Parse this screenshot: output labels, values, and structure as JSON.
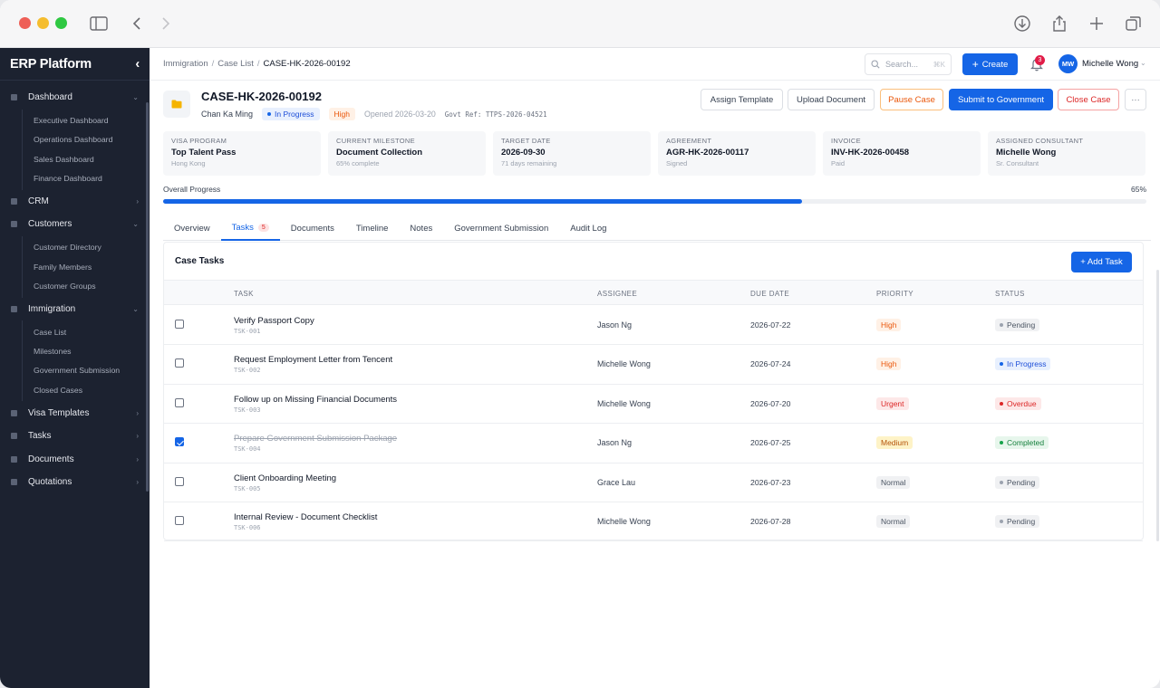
{
  "sidebar": {
    "brand": "ERP Platform",
    "groups": [
      {
        "label": "Dashboard",
        "subs": [
          "Executive Dashboard",
          "Operations Dashboard",
          "Sales Dashboard",
          "Finance Dashboard"
        ]
      },
      {
        "label": "CRM",
        "subs": []
      },
      {
        "label": "Customers",
        "subs": [
          "Customer Directory",
          "Family Members",
          "Customer Groups"
        ]
      },
      {
        "label": "Immigration",
        "subs": [
          "Case List",
          "Milestones",
          "Government Submission",
          "Closed Cases"
        ]
      },
      {
        "label": "Visa Templates",
        "subs": []
      },
      {
        "label": "Tasks",
        "subs": []
      },
      {
        "label": "Documents",
        "subs": []
      },
      {
        "label": "Quotations",
        "subs": []
      }
    ]
  },
  "topbar": {
    "breadcrumb": [
      "Immigration",
      "Case List",
      "CASE-HK-2026-00192"
    ],
    "search_placeholder": "Search...",
    "search_shortcut": "⌘K",
    "create_label": "Create",
    "notif_count": "3",
    "user_initials": "MW",
    "user_name": "Michelle Wong"
  },
  "case": {
    "id": "CASE-HK-2026-00192",
    "client": "Chan Ka Ming",
    "status": "In Progress",
    "priority": "High",
    "opened": "Opened 2026-03-20",
    "gov_ref": "Govt Ref: TTPS-2026-04521"
  },
  "actions": {
    "assign_template": "Assign Template",
    "upload_document": "Upload Document",
    "pause_case": "Pause Case",
    "submit": "Submit to Government",
    "close_case": "Close Case",
    "more": "···"
  },
  "cards": [
    {
      "key": "VISA PROGRAM",
      "value": "Top Talent Pass",
      "sub": "Hong Kong"
    },
    {
      "key": "CURRENT MILESTONE",
      "value": "Document Collection",
      "sub": "65% complete"
    },
    {
      "key": "TARGET DATE",
      "value": "2026-09-30",
      "sub": "71 days remaining"
    },
    {
      "key": "AGREEMENT",
      "value": "AGR-HK-2026-00117",
      "sub": "Signed"
    },
    {
      "key": "INVOICE",
      "value": "INV-HK-2026-00458",
      "sub": "Paid"
    },
    {
      "key": "ASSIGNED CONSULTANT",
      "value": "Michelle Wong",
      "sub": "Sr. Consultant"
    }
  ],
  "progress": {
    "label": "Overall Progress",
    "percent_text": "65%",
    "value": 0.65
  },
  "tabs": [
    {
      "label": "Overview"
    },
    {
      "label": "Tasks",
      "count": "5"
    },
    {
      "label": "Documents"
    },
    {
      "label": "Timeline"
    },
    {
      "label": "Notes"
    },
    {
      "label": "Government Submission"
    },
    {
      "label": "Audit Log"
    }
  ],
  "tasks_panel": {
    "title": "Case Tasks",
    "add_label": "+ Add Task",
    "columns": [
      "TASK",
      "ASSIGNEE",
      "DUE DATE",
      "PRIORITY",
      "STATUS"
    ],
    "rows": [
      {
        "checked": false,
        "name": "Verify Passport Copy",
        "id": "TSK-001",
        "assignee": "Jason Ng",
        "due": "2026-07-22",
        "priority": "High",
        "status": "Pending"
      },
      {
        "checked": false,
        "name": "Request Employment Letter from Tencent",
        "id": "TSK-002",
        "assignee": "Michelle Wong",
        "due": "2026-07-24",
        "priority": "High",
        "status": "In Progress"
      },
      {
        "checked": false,
        "name": "Follow up on Missing Financial Documents",
        "id": "TSK-003",
        "assignee": "Michelle Wong",
        "due": "2026-07-20",
        "priority": "Urgent",
        "status": "Overdue"
      },
      {
        "checked": true,
        "name": "Prepare Government Submission Package",
        "id": "TSK-004",
        "assignee": "Jason Ng",
        "due": "2026-07-25",
        "priority": "Medium",
        "status": "Completed"
      },
      {
        "checked": false,
        "name": "Client Onboarding Meeting",
        "id": "TSK-005",
        "assignee": "Grace Lau",
        "due": "2026-07-23",
        "priority": "Normal",
        "status": "Pending"
      },
      {
        "checked": false,
        "name": "Internal Review - Document Checklist",
        "id": "TSK-006",
        "assignee": "Michelle Wong",
        "due": "2026-07-28",
        "priority": "Normal",
        "status": "Pending"
      }
    ]
  },
  "colors": {
    "accent": "#1565e6",
    "sidebar_bg": "#1c2230",
    "priority": {
      "High": [
        "#fff1e6",
        "#ea580c"
      ],
      "Urgent": [
        "#fde8e8",
        "#dc2626"
      ],
      "Medium": [
        "#fef3c7",
        "#b45309"
      ],
      "Normal": [
        "#f0f1f3",
        "#4b5563"
      ]
    },
    "status": {
      "Pending": [
        "#f0f1f3",
        "#4b5563",
        "#9ca3af"
      ],
      "In Progress": [
        "#e8f0fe",
        "#1d4ed8",
        "#1565e6"
      ],
      "Overdue": [
        "#fde8e8",
        "#dc2626",
        "#dc2626"
      ],
      "Completed": [
        "#e7f6ec",
        "#15803d",
        "#16a34a"
      ]
    }
  }
}
